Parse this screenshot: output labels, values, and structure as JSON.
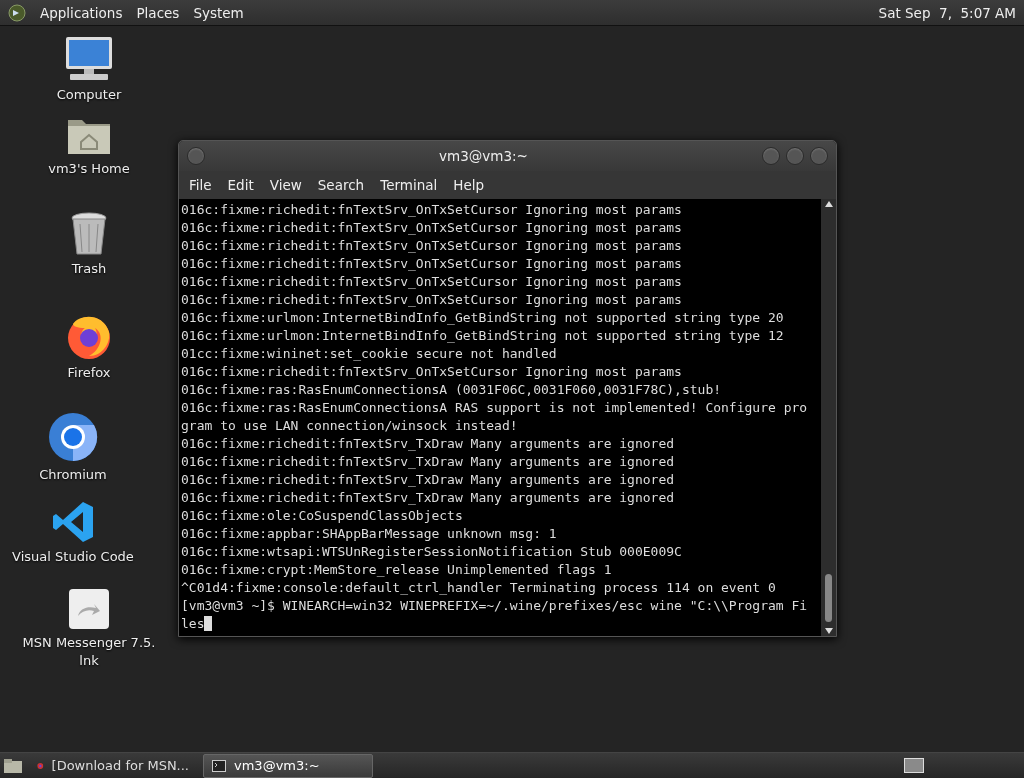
{
  "top_panel": {
    "menus": [
      "Applications",
      "Places",
      "System"
    ],
    "clock": "Sat Sep  7,  5:07 AM"
  },
  "desktop_icons": [
    {
      "kind": "computer",
      "label": "Computer"
    },
    {
      "kind": "home",
      "label": "vm3's Home"
    },
    {
      "kind": "trash",
      "label": "Trash"
    },
    {
      "kind": "firefox",
      "label": "Firefox"
    },
    {
      "kind": "chromium",
      "label": "Chromium"
    },
    {
      "kind": "vscode",
      "label": "Visual Studio Code"
    },
    {
      "kind": "shortcut",
      "label": "MSN Messenger 7.5.\nlnk"
    }
  ],
  "terminal_window": {
    "title": "vm3@vm3:~",
    "menus": [
      "File",
      "Edit",
      "View",
      "Search",
      "Terminal",
      "Help"
    ],
    "lines": [
      "016c:fixme:richedit:fnTextSrv_OnTxSetCursor Ignoring most params",
      "016c:fixme:richedit:fnTextSrv_OnTxSetCursor Ignoring most params",
      "016c:fixme:richedit:fnTextSrv_OnTxSetCursor Ignoring most params",
      "016c:fixme:richedit:fnTextSrv_OnTxSetCursor Ignoring most params",
      "016c:fixme:richedit:fnTextSrv_OnTxSetCursor Ignoring most params",
      "016c:fixme:richedit:fnTextSrv_OnTxSetCursor Ignoring most params",
      "016c:fixme:urlmon:InternetBindInfo_GetBindString not supported string type 20",
      "016c:fixme:urlmon:InternetBindInfo_GetBindString not supported string type 12",
      "01cc:fixme:wininet:set_cookie secure not handled",
      "016c:fixme:richedit:fnTextSrv_OnTxSetCursor Ignoring most params",
      "016c:fixme:ras:RasEnumConnectionsA (0031F06C,0031F060,0031F78C),stub!",
      "016c:fixme:ras:RasEnumConnectionsA RAS support is not implemented! Configure pro",
      "gram to use LAN connection/winsock instead!",
      "016c:fixme:richedit:fnTextSrv_TxDraw Many arguments are ignored",
      "016c:fixme:richedit:fnTextSrv_TxDraw Many arguments are ignored",
      "016c:fixme:richedit:fnTextSrv_TxDraw Many arguments are ignored",
      "016c:fixme:richedit:fnTextSrv_TxDraw Many arguments are ignored",
      "016c:fixme:ole:CoSuspendClassObjects",
      "016c:fixme:appbar:SHAppBarMessage unknown msg: 1",
      "016c:fixme:wtsapi:WTSUnRegisterSessionNotification Stub 000E009C",
      "016c:fixme:crypt:MemStore_release Unimplemented flags 1",
      "^C01d4:fixme:console:default_ctrl_handler Terminating process 114 on event 0",
      "[vm3@vm3 ~]$ WINEARCH=win32 WINEPREFIX=~/.wine/prefixes/esc wine \"C:\\\\Program Fi",
      "les"
    ]
  },
  "taskbar": {
    "tasks": [
      {
        "kind": "firefox",
        "label": "[Download for MSN...",
        "selected": false
      },
      {
        "kind": "terminal",
        "label": "vm3@vm3:~",
        "selected": true
      }
    ]
  }
}
